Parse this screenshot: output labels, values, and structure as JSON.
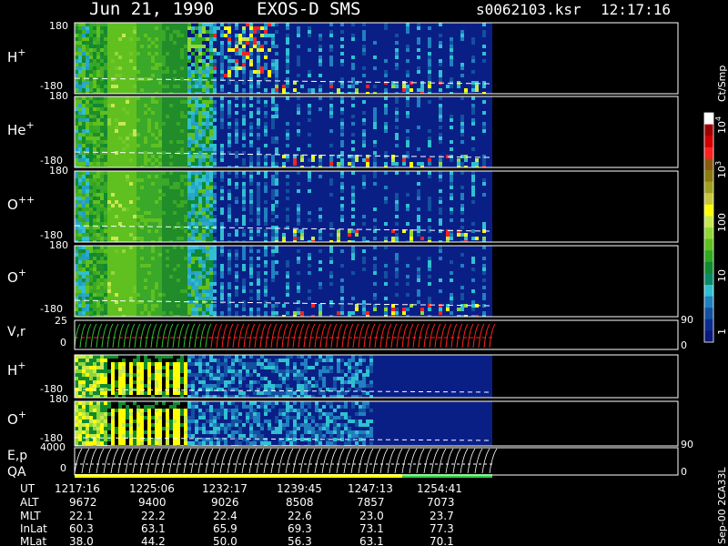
{
  "header": {
    "date": "Jun 21, 1990",
    "instrument": "EXOS-D SMS",
    "file": "s0062103.ksr",
    "time": "12:17:16"
  },
  "chart_data": {
    "type": "heatmap",
    "panels": [
      {
        "label_main": "H",
        "label_sup": "+",
        "y_top": "180",
        "y_bot": "-180"
      },
      {
        "label_main": "He",
        "label_sup": "+",
        "y_top": "180",
        "y_bot": "-180"
      },
      {
        "label_main": "O",
        "label_sup": "++",
        "y_top": "180",
        "y_bot": "-180"
      },
      {
        "label_main": "O",
        "label_sup": "+",
        "y_top": "180",
        "y_bot": "-180"
      },
      {
        "label_main": "V,r",
        "label_sup": "",
        "y_top": "25",
        "y_bot": "0",
        "r_top": "90",
        "r_bot": "0"
      },
      {
        "label_main": "H",
        "label_sup": "+",
        "y_top": "180",
        "y_bot": "-180"
      },
      {
        "label_main": "O",
        "label_sup": "+",
        "y_top": "180",
        "y_bot": "-180"
      },
      {
        "label_main": "E,p",
        "label_main2": "QA",
        "label_sup": "",
        "y_top": "4000",
        "y_bot": "0",
        "r_top": "90",
        "r_bot": "0"
      }
    ],
    "colorbar": {
      "unit": "Ct/Smp",
      "ticks": [
        {
          "base": "10",
          "exp": "4"
        },
        {
          "base": "10",
          "exp": "3"
        },
        {
          "base": "100",
          "exp": ""
        },
        {
          "base": "10",
          "exp": ""
        },
        {
          "base": "1",
          "exp": ""
        }
      ],
      "colors": [
        "#ffffff",
        "#a00000",
        "#d00000",
        "#ff2020",
        "#8a5a10",
        "#8a7a10",
        "#a0a020",
        "#c8c840",
        "#ffff00",
        "#c8e850",
        "#90d838",
        "#60c020",
        "#30a820",
        "#108a30",
        "#0a8a68",
        "#30c0d0",
        "#2080c0",
        "#1450a0",
        "#0c2c90",
        "#0a1a7a"
      ]
    },
    "x_axis": {
      "rows": [
        {
          "label": "UT",
          "values": [
            "1217:16",
            "1225:06",
            "1232:17",
            "1239:45",
            "1247:13",
            "1254:41"
          ]
        },
        {
          "label": "ALT",
          "values": [
            "9672",
            "9400",
            "9026",
            "8508",
            "7857",
            "7073"
          ]
        },
        {
          "label": "MLT",
          "values": [
            "22.1",
            "22.2",
            "22.4",
            "22.6",
            "23.0",
            "23.7"
          ]
        },
        {
          "label": "InLat",
          "values": [
            "60.3",
            "63.1",
            "65.9",
            "69.3",
            "73.1",
            "77.3"
          ]
        },
        {
          "label": "MLat",
          "values": [
            "38.0",
            "44.2",
            "50.0",
            "56.3",
            "63.1",
            "70.1"
          ]
        }
      ]
    },
    "side_note": "Sep-00  2CA33L"
  }
}
